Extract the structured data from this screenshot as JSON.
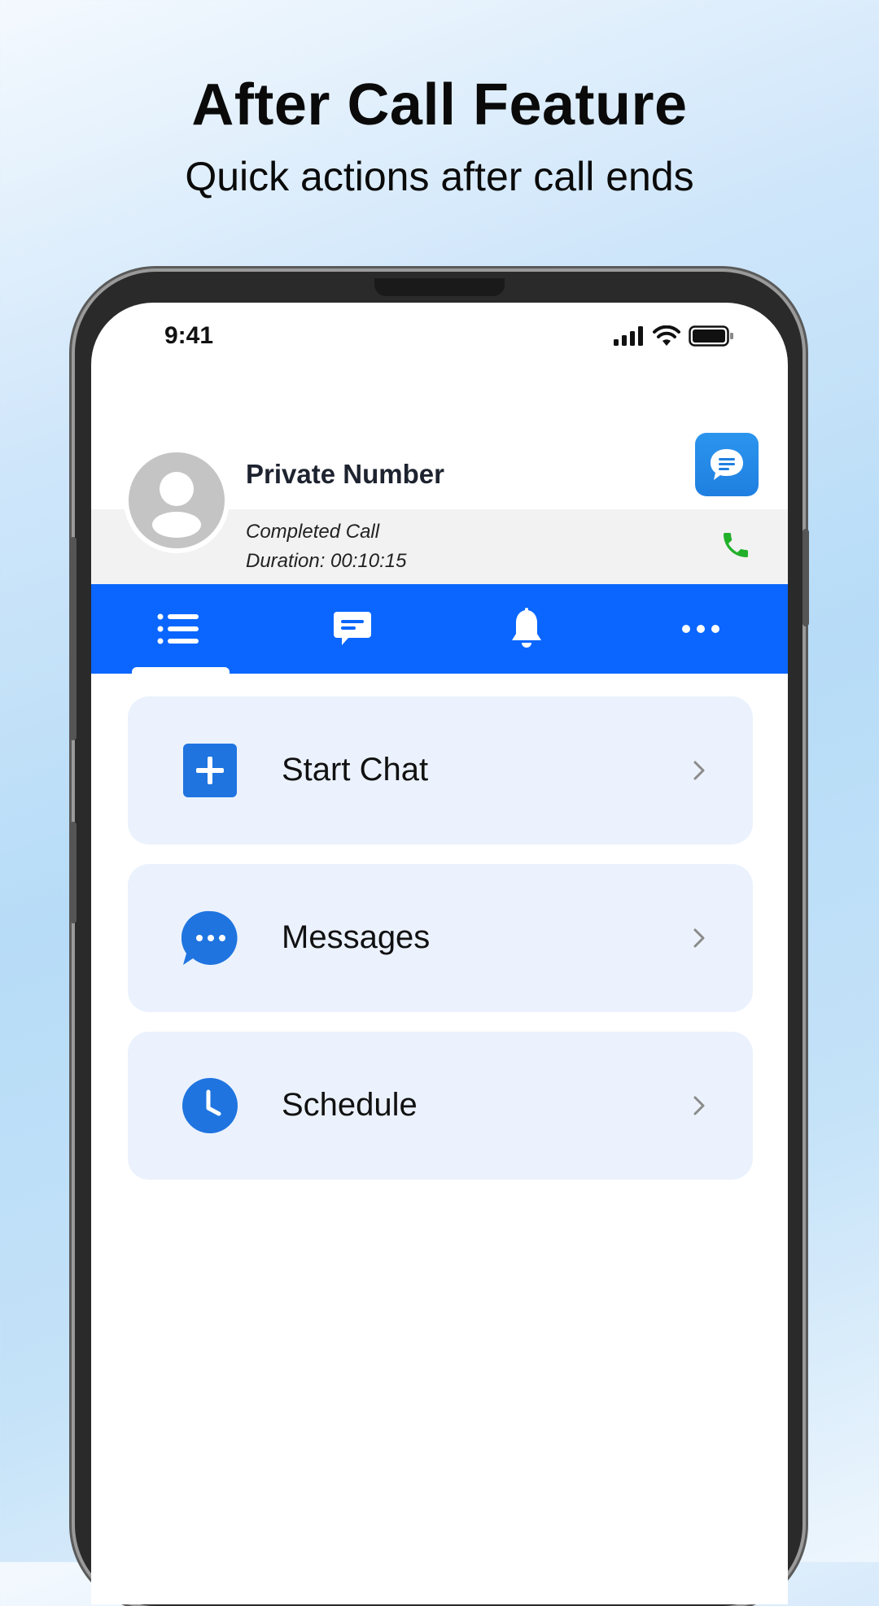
{
  "promo": {
    "title": "After Call Feature",
    "subtitle": "Quick actions after call ends"
  },
  "status_bar": {
    "time": "9:41",
    "icons": [
      "signal-icon",
      "wifi-icon",
      "battery-icon"
    ]
  },
  "call": {
    "caller_name": "Private Number",
    "status": "Completed Call",
    "duration": "Duration: 00:10:15"
  },
  "tabs": [
    {
      "name": "list",
      "icon": "list-icon",
      "active": true
    },
    {
      "name": "messages",
      "icon": "chat-icon",
      "active": false
    },
    {
      "name": "reminders",
      "icon": "bell-icon",
      "active": false
    },
    {
      "name": "more",
      "icon": "more-icon",
      "active": false
    }
  ],
  "actions": [
    {
      "label": "Start Chat",
      "icon": "plus-icon"
    },
    {
      "label": "Messages",
      "icon": "chat-bubble-icon"
    },
    {
      "label": "Schedule",
      "icon": "clock-icon"
    }
  ],
  "colors": {
    "tab_bar": "#0a66ff",
    "action_icon": "#1f74e0",
    "action_card_bg": "#ebf2fd",
    "call_green": "#22b02b"
  }
}
